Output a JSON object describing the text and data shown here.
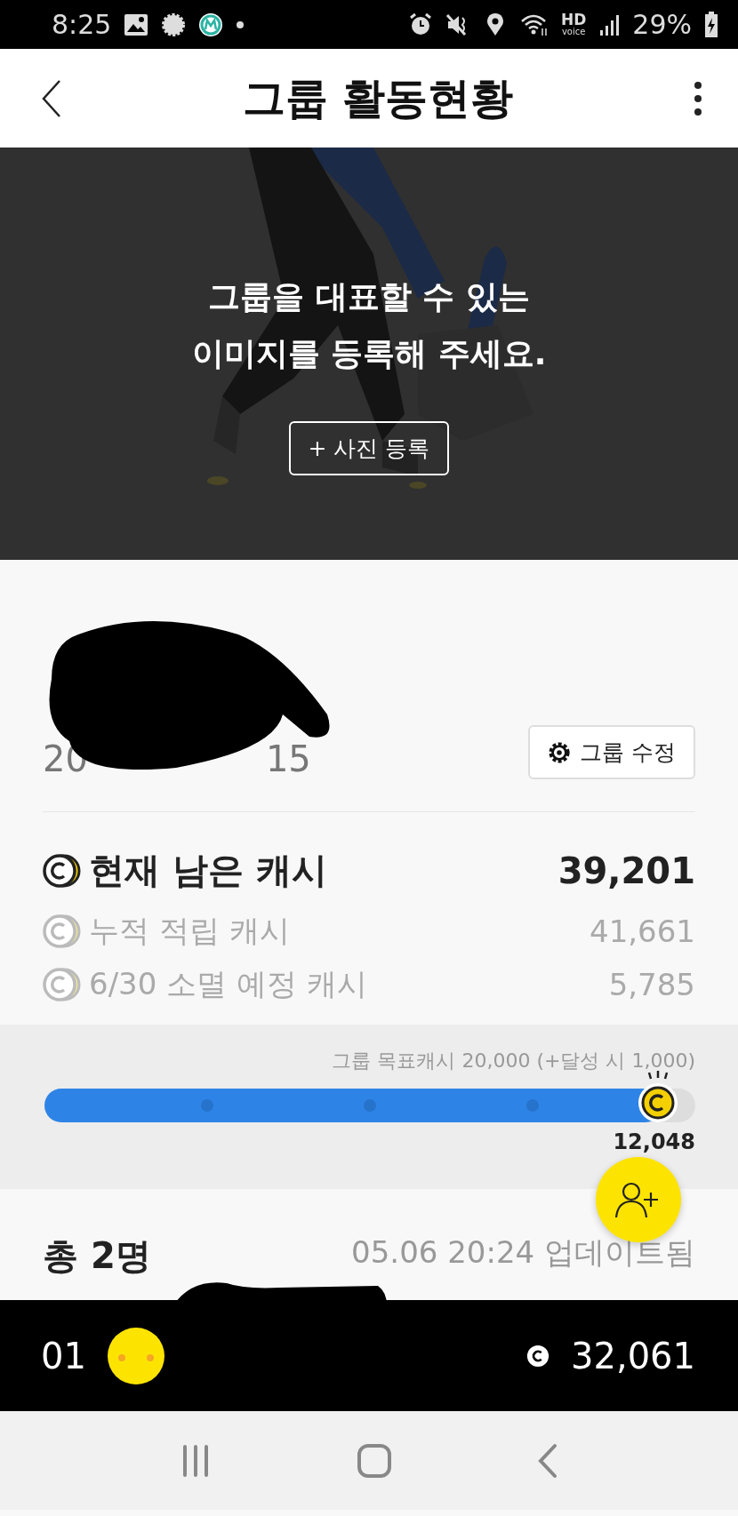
{
  "status_bar": {
    "time": "8:25",
    "hd_label": "HD",
    "voice_label": "voice",
    "battery": "29%"
  },
  "app_bar": {
    "title": "그룹 활동현황"
  },
  "hero": {
    "kind": "picture",
    "message_lines": [
      "그룹을 대표할 수 있는",
      "이미지를 등록해 주세요."
    ],
    "button": "+ 사진 등록"
  },
  "group": {
    "date_start": "20",
    "date_end": "15",
    "edit_button": "그룹 수정"
  },
  "cash": [
    {
      "kind": "primary",
      "label": "현재 남은 캐시",
      "value": "39,201"
    },
    {
      "kind": "secondary",
      "label": "누적 적립 캐시",
      "value": "41,661"
    },
    {
      "kind": "secondary",
      "label": "6/30 소멸 예정 캐시",
      "value": "5,785"
    }
  ],
  "goal": {
    "caption": "그룹 목표캐시 20,000 (+달성 시 1,000)",
    "amount": "12,048"
  },
  "members": {
    "total": "총 2명",
    "updated": "05.06 20:24 업데이트됨"
  },
  "my_rank": {
    "rank": "01",
    "cash": "32,061"
  }
}
